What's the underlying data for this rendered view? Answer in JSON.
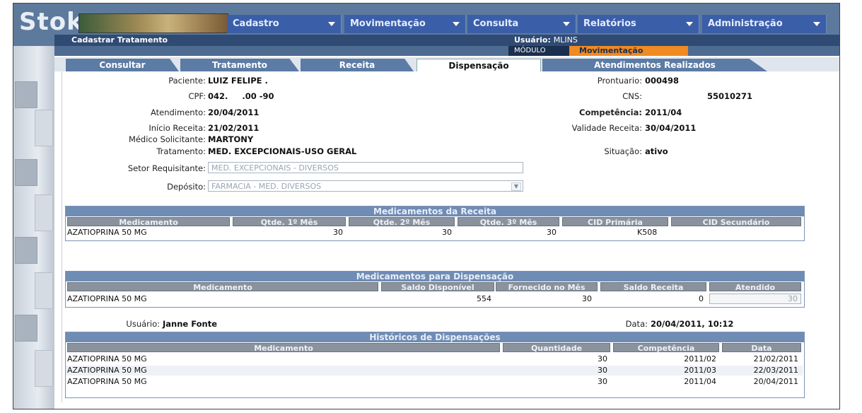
{
  "app": {
    "logo": "Stok",
    "menus": [
      "Cadastro",
      "Movimentação",
      "Consulta",
      "Relatórios",
      "Administração"
    ],
    "page_title": "Cadastrar Tratamento",
    "usuario_label": "Usuário:",
    "usuario_value": "MLINS",
    "modulo_label": "MÓDULO",
    "modulo_value": "Movimentação"
  },
  "tabs": [
    "Consultar",
    "Tratamento",
    "Receita",
    "Dispensação",
    "Atendimentos Realizados"
  ],
  "active_tab": "Dispensação",
  "patient": {
    "paciente_label": "Paciente:",
    "paciente": "LUIZ FELIPE .",
    "cpf_label": "CPF:",
    "cpf": "042.     .00 -90",
    "atendimento_label": "Atendimento:",
    "atendimento": "20/04/2011",
    "inicio_label": "Início Receita:",
    "inicio": "21/02/2011",
    "medico_label": "Médico Solicitante:",
    "medico": "MARTONY",
    "tratamento_label": "Tratamento:",
    "tratamento": "MED. EXCEPCIONAIS-USO GERAL",
    "setor_label": "Setor Requisitante:",
    "setor": "MED. EXCEPCIONAIS - DIVERSOS",
    "deposito_label": "Depósito:",
    "deposito": "FARMACIA - MED. DIVERSOS",
    "prontuario_label": "Prontuario:",
    "prontuario": "000498",
    "cns_label": "CNS:",
    "cns": "55010271",
    "competencia_label": "Competência:",
    "competencia": "2011/04",
    "validade_label": "Validade Receita:",
    "validade": "30/04/2011",
    "situacao_label": "Situação:",
    "situacao": "ativo"
  },
  "receita": {
    "title": "Medicamentos da Receita",
    "headers": [
      "Medicamento",
      "Qtde. 1º Mês",
      "Qtde. 2º Mês",
      "Qtde. 3º Mês",
      "CID Primária",
      "CID Secundário"
    ],
    "row": {
      "medicamento": "AZATIOPRINA 50 MG",
      "q1": "30",
      "q2": "30",
      "q3": "30",
      "cid1": "K508",
      "cid2": ""
    }
  },
  "dispensacao": {
    "title": "Medicamentos para Dispensação",
    "headers": [
      "Medicamento",
      "Saldo Disponível",
      "Fornecido no Mês",
      "Saldo Receita",
      "Atendido"
    ],
    "row": {
      "medicamento": "AZATIOPRINA 50 MG",
      "saldo": "554",
      "fornecido": "30",
      "saldo_receita": "0",
      "atendido": "30"
    }
  },
  "user_line": {
    "usuario_label": "Usuário:",
    "usuario": "Janne Fonte",
    "data_label": "Data:",
    "data": "20/04/2011, 10:12"
  },
  "historico": {
    "title": "Históricos de Dispensações",
    "headers": [
      "Medicamento",
      "Quantidade",
      "Competência",
      "Data"
    ],
    "rows": [
      {
        "medicamento": "AZATIOPRINA 50 MG",
        "quantidade": "30",
        "competencia": "2011/02",
        "data": "21/02/2011"
      },
      {
        "medicamento": "AZATIOPRINA 50 MG",
        "quantidade": "30",
        "competencia": "2011/03",
        "data": "22/03/2011"
      },
      {
        "medicamento": "AZATIOPRINA 50 MG",
        "quantidade": "30",
        "competencia": "2011/04",
        "data": "20/04/2011"
      }
    ]
  }
}
